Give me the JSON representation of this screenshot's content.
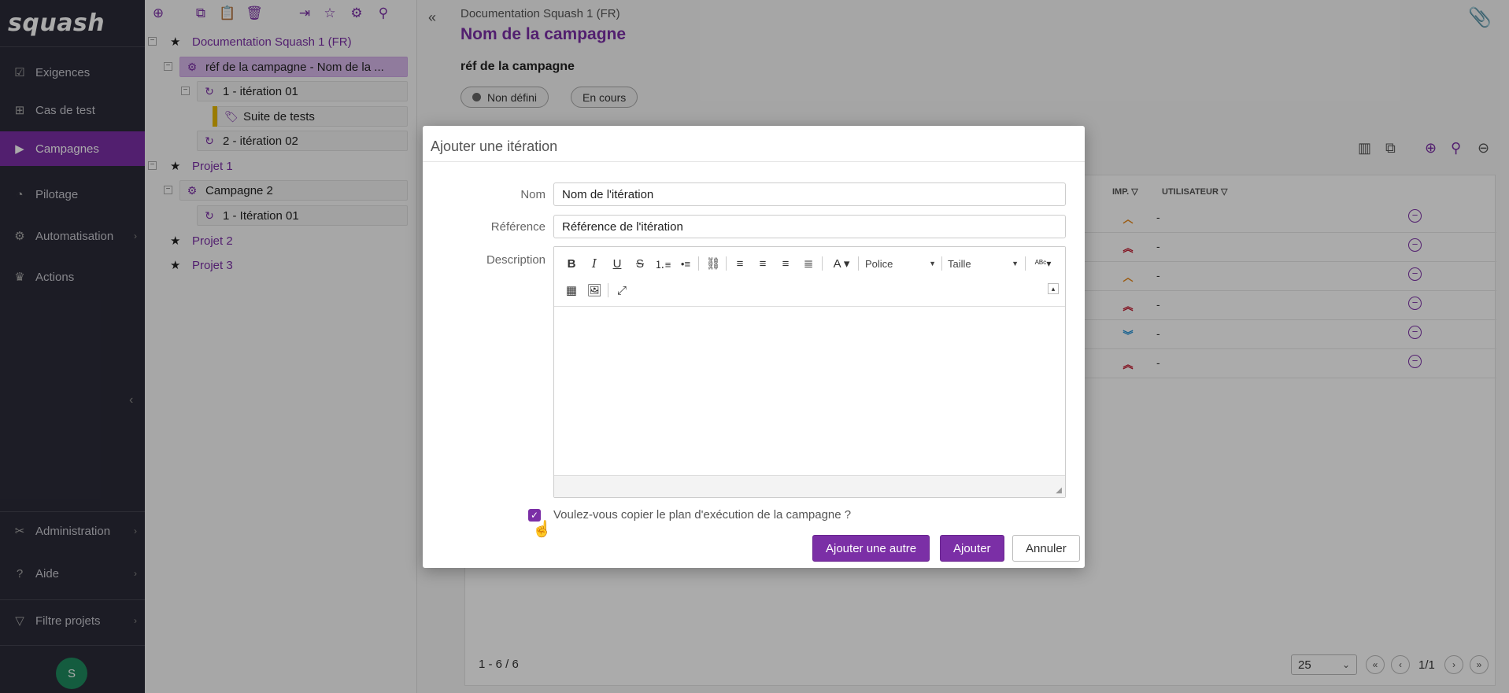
{
  "brand": {
    "logo_text": "squash"
  },
  "nav": {
    "items": [
      {
        "label": "Exigences",
        "icon": "requirements-icon"
      },
      {
        "label": "Cas de test",
        "icon": "test-case-icon"
      },
      {
        "label": "Campagnes",
        "icon": "campaign-icon",
        "active": true
      },
      {
        "label": "Pilotage",
        "icon": "pie-chart-icon"
      },
      {
        "label": "Automatisation",
        "icon": "robot-icon"
      },
      {
        "label": "Actions",
        "icon": "crown-icon"
      }
    ],
    "bottom_items": [
      {
        "label": "Administration",
        "icon": "wrench-icon"
      },
      {
        "label": "Aide",
        "icon": "help-icon"
      },
      {
        "label": "Filtre projets",
        "icon": "filter-icon"
      }
    ],
    "avatar_initial": "S"
  },
  "tree": {
    "nodes": {
      "project_doc": "Documentation Squash 1 (FR)",
      "campaign_selected": "réf de la campagne - Nom de la ...",
      "iteration_1": "1 - itération 01",
      "suite": "Suite de tests",
      "iteration_2": "2 - itération 02",
      "project_1": "Projet 1",
      "campaign_2": "Campagne 2",
      "iteration_1b": "1 - Itération 01",
      "project_2": "Projet 2",
      "project_3": "Projet 3"
    }
  },
  "main": {
    "breadcrumb": "Documentation Squash 1 (FR)",
    "title": "Nom de la campagne",
    "reference": "réf de la campagne",
    "status_pill": "Non défini",
    "progress_pill": "En cours",
    "table": {
      "headers": {
        "imp": "IMP.",
        "user": "UTILISATEUR"
      },
      "rows": [
        {
          "imp": "medium",
          "user": "-"
        },
        {
          "imp": "high",
          "user": "-"
        },
        {
          "imp": "medium",
          "user": "-"
        },
        {
          "imp": "high",
          "user": "-"
        },
        {
          "imp": "low",
          "user": "-"
        },
        {
          "imp": "high",
          "user": "-"
        }
      ],
      "count": "1 - 6 / 6",
      "page_size": "25",
      "page": "1/1"
    }
  },
  "dialog": {
    "title": "Ajouter une itération",
    "name_label": "Nom",
    "name_value": "Nom de l'itération",
    "reference_label": "Référence",
    "reference_value": "Référence de l'itération",
    "description_label": "Description",
    "font_label": "Police",
    "size_label": "Taille",
    "copy_plan_label": "Voulez-vous copier le plan d'exécution de la campagne ?",
    "copy_plan_checked": true,
    "add_another_label": "Ajouter une autre",
    "add_label": "Ajouter",
    "cancel_label": "Annuler"
  },
  "colors": {
    "accent": "#7b2fa6",
    "nav_bg": "#2b2b38",
    "imp_high": "#c0152b",
    "imp_medium": "#e8891c",
    "imp_low": "#1f8fd6"
  }
}
